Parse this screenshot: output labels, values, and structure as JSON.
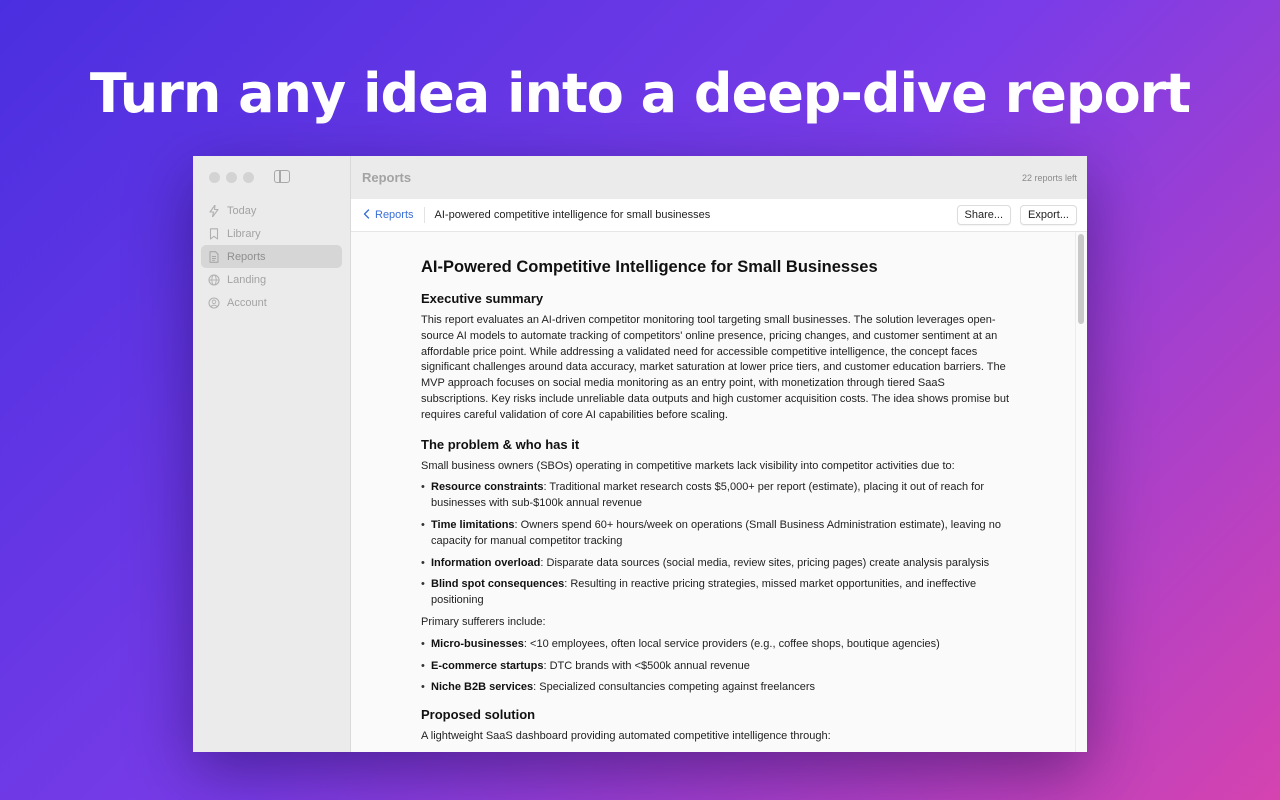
{
  "hero": {
    "headline": "Turn any idea into a deep-dive report"
  },
  "sidebar": {
    "items": [
      {
        "label": "Today",
        "icon": "bolt-icon"
      },
      {
        "label": "Library",
        "icon": "bookmark-icon"
      },
      {
        "label": "Reports",
        "icon": "document-icon",
        "active": true
      },
      {
        "label": "Landing",
        "icon": "globe-icon"
      },
      {
        "label": "Account",
        "icon": "person-circle-icon"
      }
    ]
  },
  "titlebar": {
    "title": "Reports",
    "reports_left": "22 reports left"
  },
  "toolbar": {
    "back_label": "Reports",
    "breadcrumb": "AI-powered competitive intelligence for small businesses",
    "share_label": "Share...",
    "export_label": "Export..."
  },
  "report": {
    "title": "AI-Powered Competitive Intelligence for Small Businesses",
    "sections": {
      "summary_heading": "Executive summary",
      "summary_text": "This report evaluates an AI-driven competitor monitoring tool targeting small businesses. The solution leverages open-source AI models to automate tracking of competitors' online presence, pricing changes, and customer sentiment at an affordable price point. While addressing a validated need for accessible competitive intelligence, the concept faces significant challenges around data accuracy, market saturation at lower price tiers, and customer education barriers. The MVP approach focuses on social media monitoring as an entry point, with monetization through tiered SaaS subscriptions. Key risks include unreliable data outputs and high customer acquisition costs. The idea shows promise but requires careful validation of core AI capabilities before scaling.",
      "problem_heading": "The problem & who has it",
      "problem_intro": "Small business owners (SBOs) operating in competitive markets lack visibility into competitor activities due to:",
      "problem_items": [
        {
          "term": "Resource constraints",
          "text": ": Traditional market research costs $5,000+ per report (estimate), placing it out of reach for businesses with sub-$100k annual revenue"
        },
        {
          "term": "Time limitations",
          "text": ": Owners spend 60+ hours/week on operations (Small Business Administration estimate), leaving no capacity for manual competitor tracking"
        },
        {
          "term": "Information overload",
          "text": ": Disparate data sources (social media, review sites, pricing pages) create analysis paralysis"
        },
        {
          "term": "Blind spot consequences",
          "text": ": Resulting in reactive pricing strategies, missed market opportunities, and ineffective positioning"
        }
      ],
      "sufferers_intro": "Primary sufferers include:",
      "sufferers_items": [
        {
          "term": "Micro-businesses",
          "text": ": <10 employees, often local service providers (e.g., coffee shops, boutique agencies)"
        },
        {
          "term": "E-commerce startups",
          "text": ": DTC brands with <$500k annual revenue"
        },
        {
          "term": "Niche B2B services",
          "text": ": Specialized consultancies competing against freelancers"
        }
      ],
      "solution_heading": "Proposed solution",
      "solution_intro": "A lightweight SaaS dashboard providing automated competitive intelligence through:"
    }
  },
  "colors": {
    "accent": "#3a6fd8",
    "sidebar_bg": "#ebebeb",
    "hero_start": "#4a2fe0",
    "hero_end": "#d543b0"
  }
}
